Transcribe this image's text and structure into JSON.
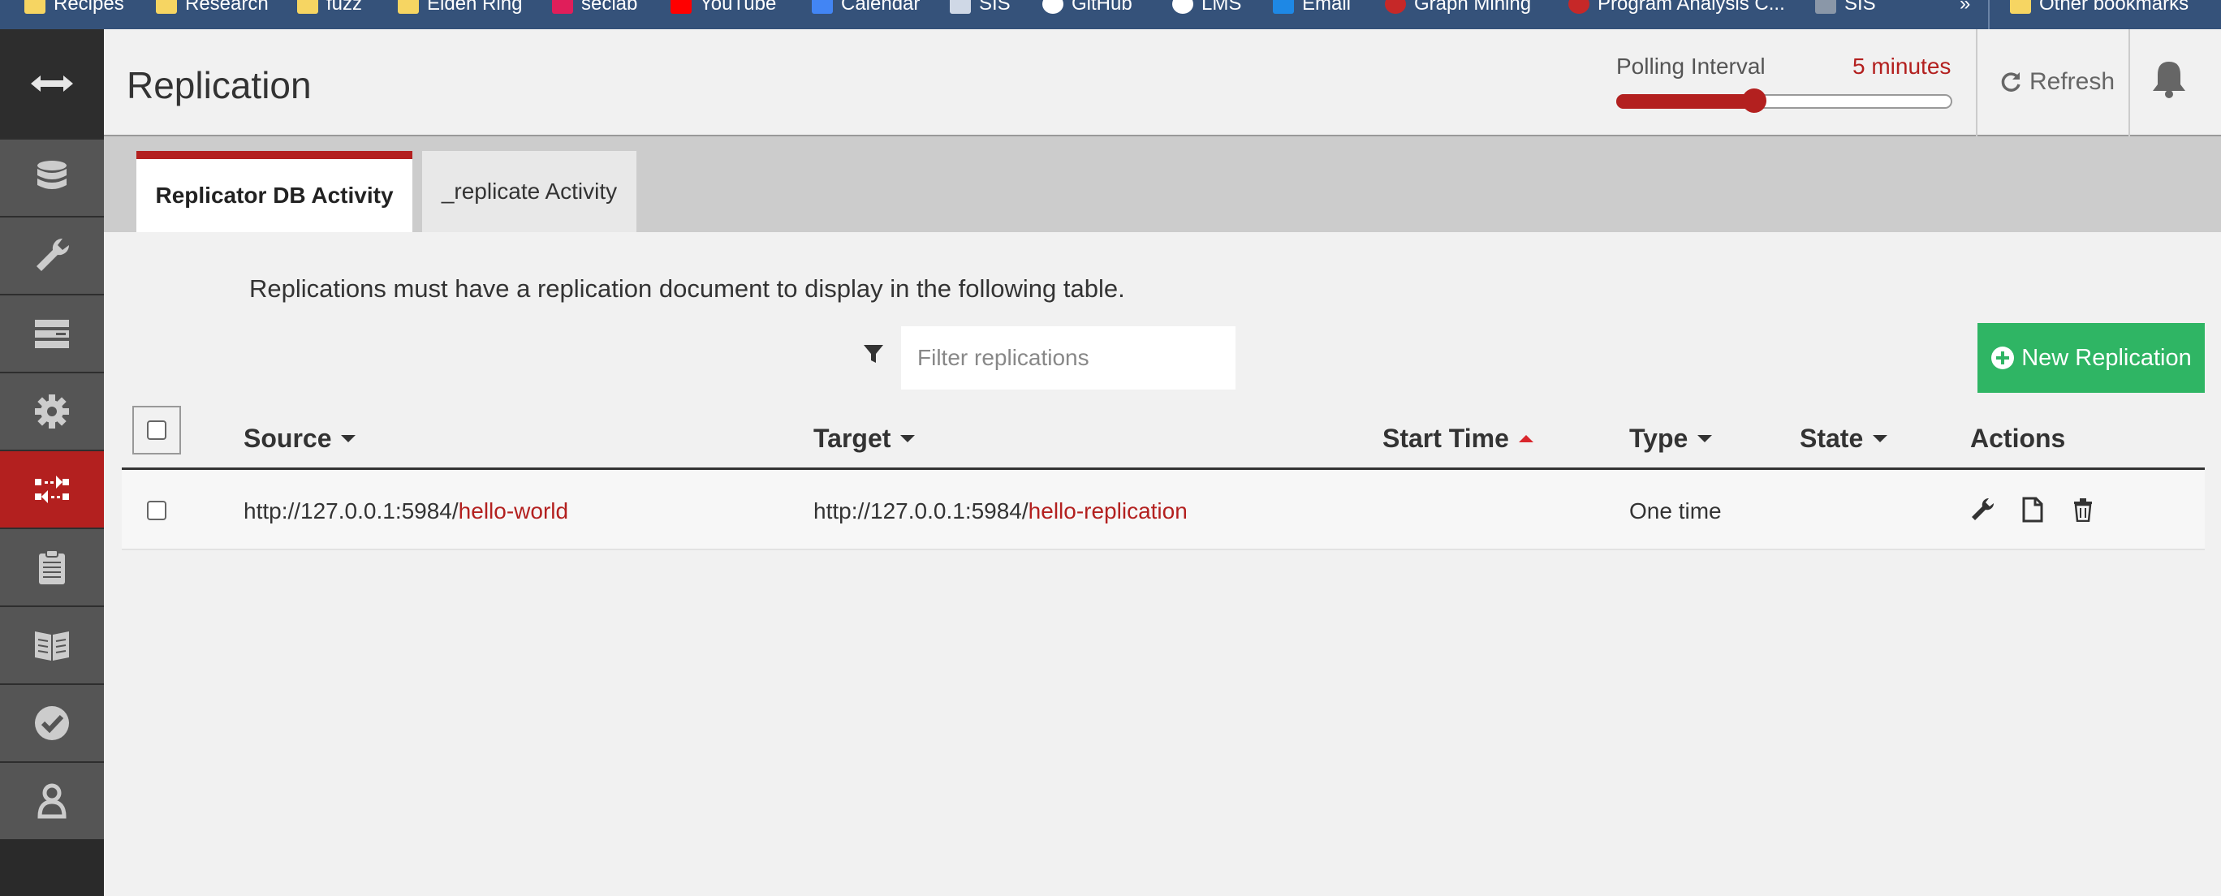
{
  "bookmarks": [
    {
      "label": "Recipes",
      "icon": "folder-icon"
    },
    {
      "label": "Research",
      "icon": "folder-icon"
    },
    {
      "label": "fuzz",
      "icon": "folder-icon"
    },
    {
      "label": "Elden Ring",
      "icon": "folder-icon"
    },
    {
      "label": "seclab",
      "icon": "slack-icon"
    },
    {
      "label": "YouTube",
      "icon": "youtube-icon"
    },
    {
      "label": "Calendar",
      "icon": "calendar-icon"
    },
    {
      "label": "SIS",
      "icon": "sis-icon"
    },
    {
      "label": "GitHub",
      "icon": "github-icon"
    },
    {
      "label": "LMS",
      "icon": "globe-icon"
    },
    {
      "label": "Email",
      "icon": "email-icon"
    },
    {
      "label": "Graph Mining",
      "icon": "cs-icon"
    },
    {
      "label": "Program Analysis C...",
      "icon": "cs-icon"
    },
    {
      "label": "SIS",
      "icon": "sis-icon"
    }
  ],
  "bookmarks_overflow": "»",
  "other_bookmarks": "Other bookmarks",
  "sidebar": {
    "items": [
      {
        "name": "databases",
        "icon": "database-icon"
      },
      {
        "name": "setup",
        "icon": "wrench-icon"
      },
      {
        "name": "active-tasks",
        "icon": "server-icon"
      },
      {
        "name": "config",
        "icon": "gear-icon"
      },
      {
        "name": "replication",
        "icon": "replication-icon",
        "active": true
      },
      {
        "name": "documentation",
        "icon": "clipboard-icon"
      },
      {
        "name": "docs",
        "icon": "book-icon"
      },
      {
        "name": "verify",
        "icon": "check-icon"
      },
      {
        "name": "user",
        "icon": "user-icon"
      }
    ]
  },
  "header": {
    "title": "Replication",
    "polling_label": "Polling Interval",
    "polling_value": "5 minutes",
    "polling_fraction": 0.41,
    "refresh_label": "Refresh"
  },
  "tabs": [
    {
      "label": "Replicator DB Activity",
      "active": true
    },
    {
      "label": "_replicate Activity",
      "active": false
    }
  ],
  "main": {
    "notice": "Replications must have a replication document to display in the following table.",
    "filter_placeholder": "Filter replications",
    "new_button": "New Replication"
  },
  "table": {
    "columns": [
      "Source",
      "Target",
      "Start Time",
      "Type",
      "State",
      "Actions"
    ],
    "rows": [
      {
        "source_host": "http://127.0.0.1:5984/",
        "source_db": "hello-world",
        "target_host": "http://127.0.0.1:5984/",
        "target_db": "hello-replication",
        "start_time": "",
        "type": "One time",
        "state": ""
      }
    ]
  },
  "colors": {
    "accent": "#b3201f",
    "success": "#2fb564",
    "bookmark_bar": "#35527a"
  }
}
